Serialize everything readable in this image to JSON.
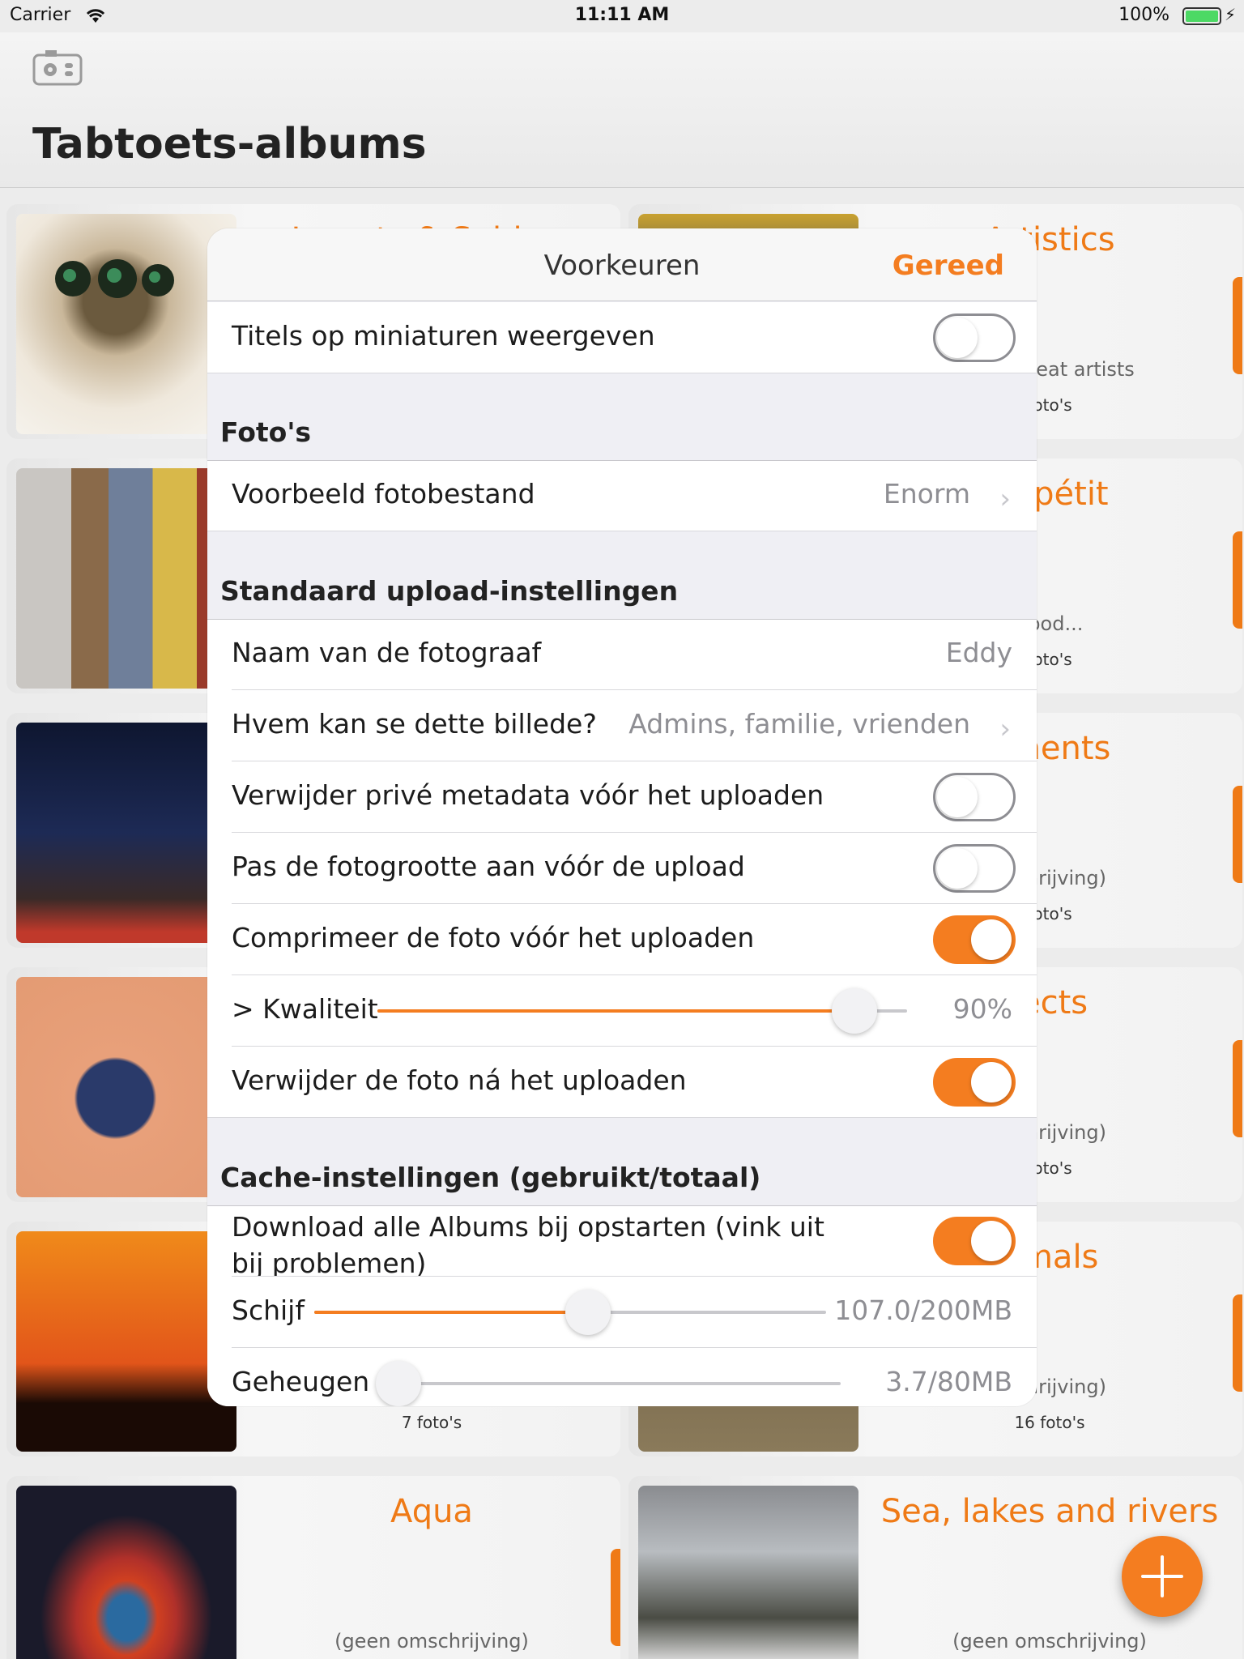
{
  "status_bar": {
    "carrier": "Carrier",
    "time": "11:11 AM",
    "battery": "100%"
  },
  "header": {
    "title": "Tabtoets-albums",
    "settings_icon": "camera-settings-icon"
  },
  "albums": [
    {
      "name": "Insects & Spiders",
      "description": "",
      "count": ""
    },
    {
      "name": "Artistics",
      "description": "from great artists",
      "count": "foto's"
    },
    {
      "name": "",
      "description": "",
      "count": ""
    },
    {
      "name": "Appétit",
      "description": "good...",
      "count": "foto's"
    },
    {
      "name": "",
      "description": "",
      "count": ""
    },
    {
      "name": "uments",
      "description": "nschrijving)",
      "count": "foto's"
    },
    {
      "name": "",
      "description": "",
      "count": ""
    },
    {
      "name": "jects",
      "description": "nschrijving)",
      "count": "foto's"
    },
    {
      "name": "",
      "description": "",
      "count": "7 foto's"
    },
    {
      "name": "nmals",
      "description": "nschrijving)",
      "count": "16 foto's"
    },
    {
      "name": "Aqua",
      "description": "(geen omschrijving)",
      "count": ""
    },
    {
      "name": "Sea, lakes and rivers",
      "description": "(geen omschrijving)",
      "count": ""
    }
  ],
  "preferences": {
    "title": "Voorkeuren",
    "done": "Gereed",
    "show_titles": {
      "label": "Titels op miniaturen weergeven",
      "on": false
    },
    "photos_section": "Foto's",
    "preview_file": {
      "label": "Voorbeeld fotobestand",
      "value": "Enorm"
    },
    "upload_section": "Standaard upload-instellingen",
    "photographer": {
      "label": "Naam van de fotograaf",
      "value": "Eddy"
    },
    "visibility": {
      "label": "Hvem kan se dette billede?",
      "value": "Admins, familie, vrienden"
    },
    "strip_metadata": {
      "label": "Verwijder privé metadata vóór het uploaden",
      "on": false
    },
    "resize": {
      "label": "Pas de fotogrootte aan vóór de upload",
      "on": false
    },
    "compress": {
      "label": "Comprimeer de foto vóór het uploaden",
      "on": true
    },
    "quality": {
      "label": "> Kwaliteit",
      "value": "90%",
      "level": 0.9
    },
    "delete_after": {
      "label": "Verwijder de foto ná het uploaden",
      "on": true
    },
    "cache_section": "Cache-instellingen (gebruikt/totaal)",
    "download_all": {
      "label_line1": "Download alle Albums bij opstarten (vink uit",
      "label_line2": "bij problemen)",
      "on": true
    },
    "disk": {
      "label": "Schijf",
      "value": "107.0/200MB",
      "level": 0.535
    },
    "memory": {
      "label": "Geheugen",
      "value": "3.7/80MB",
      "level": 0.0463
    }
  },
  "colors": {
    "accent": "#f47d20",
    "album_title": "#ef7a16"
  }
}
